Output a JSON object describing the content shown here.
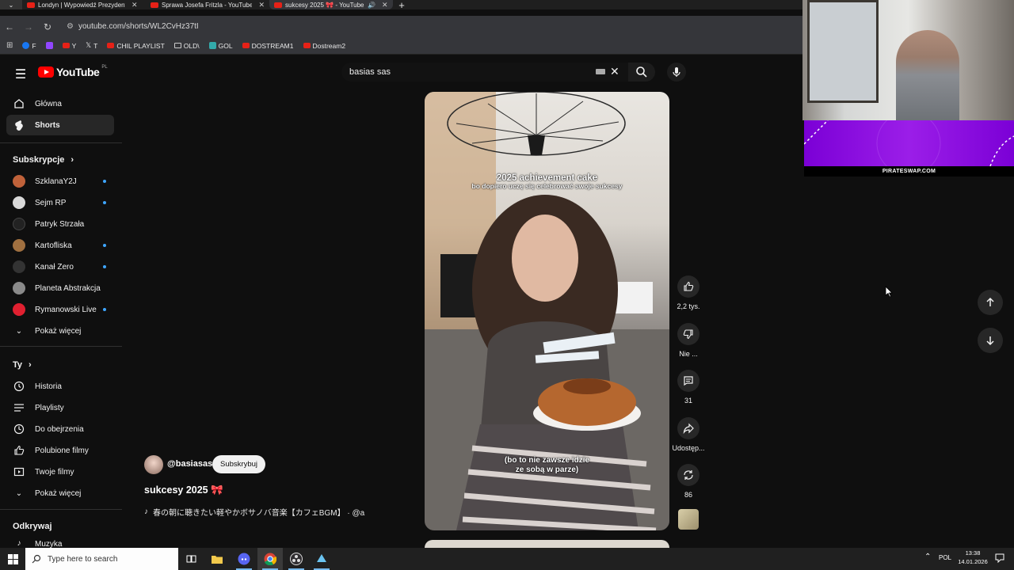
{
  "browser": {
    "tabs": [
      {
        "title": "Londyn | Wypowiedź Prezydent"
      },
      {
        "title": "Sprawa Josefa Fritzla - YouTube"
      },
      {
        "title": "sukcesy 2025 🎀 - YouTube"
      }
    ],
    "url": "youtube.com/shorts/WL2CvHz37tI",
    "bookmarks": [
      {
        "label": "F",
        "icon": "facebook-icon"
      },
      {
        "label": "",
        "icon": "twitch-icon"
      },
      {
        "label": "Y",
        "icon": "youtube-icon"
      },
      {
        "label": "T",
        "icon": "x-icon"
      },
      {
        "label": "CHIL PLAYLIST",
        "icon": "youtube-icon"
      },
      {
        "label": "OLD\\",
        "icon": "folder-icon"
      },
      {
        "label": "GOL",
        "icon": "gol-icon"
      },
      {
        "label": "DOSTREAM1",
        "icon": "youtube-icon"
      },
      {
        "label": "Dostream2",
        "icon": "youtube-icon"
      }
    ]
  },
  "youtube": {
    "logo_text": "YouTube",
    "country_code": "PL",
    "search_query": "basias sas"
  },
  "sidebar": {
    "main": [
      {
        "label": "Główna",
        "icon": "home-icon"
      },
      {
        "label": "Shorts",
        "icon": "shorts-icon"
      }
    ],
    "subscriptions_heading": "Subskrypcje",
    "subscriptions": [
      {
        "label": "SzklanaY2J",
        "color": "#c0623a",
        "dot": true
      },
      {
        "label": "Sejm RP",
        "color": "#d9d9d9",
        "dot": true
      },
      {
        "label": "Patryk Strzała",
        "color": "#222222",
        "dot": false
      },
      {
        "label": "Kartofliska",
        "color": "#a07040",
        "dot": true
      },
      {
        "label": "Kanał Zero",
        "color": "#333333",
        "dot": true
      },
      {
        "label": "Planeta Abstrakcja",
        "color": "#8a8a8a",
        "dot": false
      },
      {
        "label": "Rymanowski Live",
        "color": "#e02030",
        "dot": true
      }
    ],
    "show_more": "Pokaż więcej",
    "you_heading": "Ty",
    "you_items": [
      {
        "label": "Historia",
        "icon": "history-icon"
      },
      {
        "label": "Playlisty",
        "icon": "playlist-icon"
      },
      {
        "label": "Do obejrzenia",
        "icon": "clock-icon"
      },
      {
        "label": "Polubione filmy",
        "icon": "thumb-up-icon"
      },
      {
        "label": "Twoje filmy",
        "icon": "video-icon"
      }
    ],
    "show_more_2": "Pokaż więcej",
    "explore_heading": "Odkrywaj",
    "explore_items": [
      {
        "label": "Muzyka",
        "icon": "music-icon"
      }
    ]
  },
  "short": {
    "overlay_title": "2025 achievement cake",
    "overlay_subtitle": "bo dopiero uczę się celebrować swoje sukcesy",
    "caption": "(bo to nie zawsze idzie\nze sobą w parze)",
    "channel": "@basiasas",
    "subscribe_label": "Subskrybuj",
    "title": "sukcesy 2025 🎀",
    "music": "春の朝に聴きたい軽やかボサノバ音楽【カフェBGM】 · @a",
    "actions": {
      "like_count": "2,2 tys.",
      "dislike_label": "Nie ...",
      "comments_count": "31",
      "share_label": "Udostęp...",
      "remix_count": "86"
    }
  },
  "overlay": {
    "banner_text": "PIRATESWAP.COM"
  },
  "taskbar": {
    "search_placeholder": "Type here to search",
    "language": "POL",
    "time": "13:38",
    "date": "14.01.2026"
  }
}
